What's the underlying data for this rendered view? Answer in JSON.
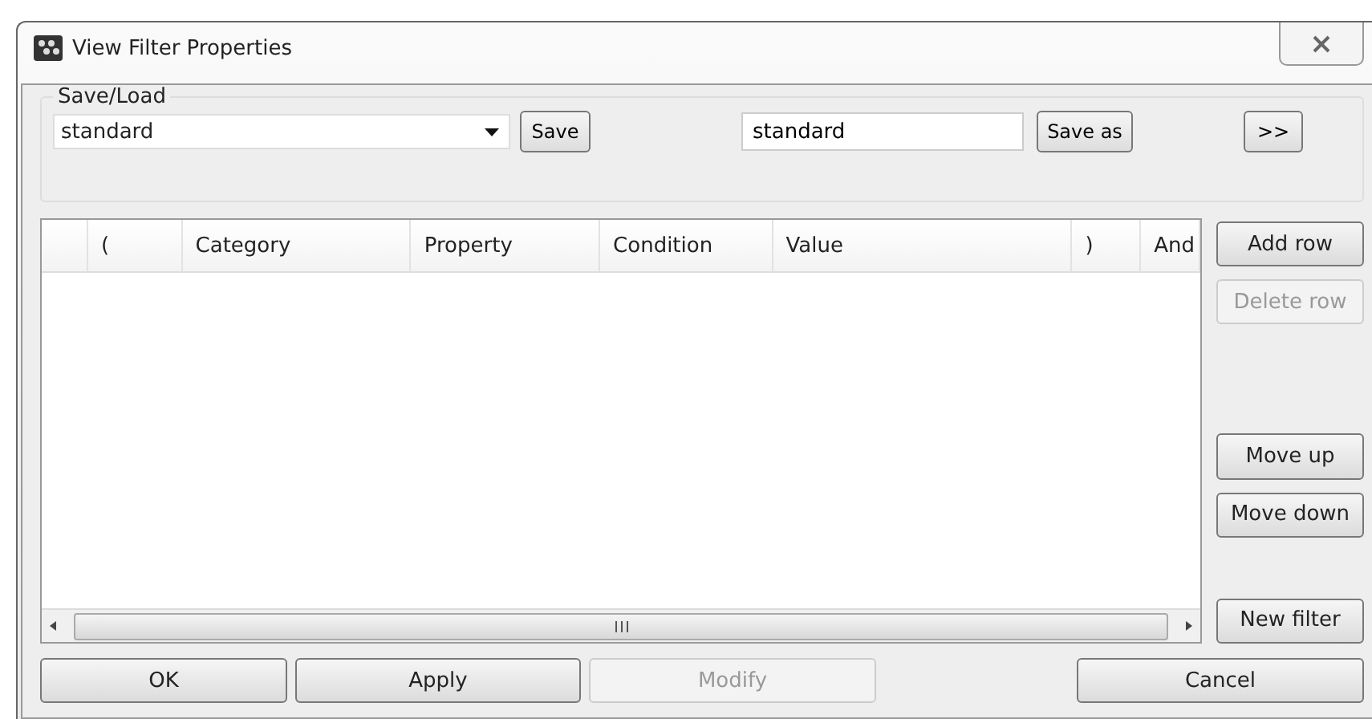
{
  "window": {
    "title": "View Filter Properties"
  },
  "save_load": {
    "label": "Save/Load",
    "combo_value": "standard",
    "save_button": "Save",
    "name_value": "standard",
    "save_as_button": "Save as",
    "more_button": ">>"
  },
  "table": {
    "columns": [
      "(",
      "Category",
      "Property",
      "Condition",
      "Value",
      ")",
      "And"
    ]
  },
  "side_buttons": [
    {
      "label": "Add row",
      "disabled": false
    },
    {
      "label": "Delete row",
      "disabled": true
    },
    {
      "label": "Move up",
      "disabled": false
    },
    {
      "label": "Move down",
      "disabled": false
    },
    {
      "label": "New filter",
      "disabled": false
    }
  ],
  "footer_buttons": [
    {
      "label": "OK",
      "disabled": false
    },
    {
      "label": "Apply",
      "disabled": false
    },
    {
      "label": "Modify",
      "disabled": true
    },
    {
      "label": "Cancel",
      "disabled": false
    }
  ]
}
